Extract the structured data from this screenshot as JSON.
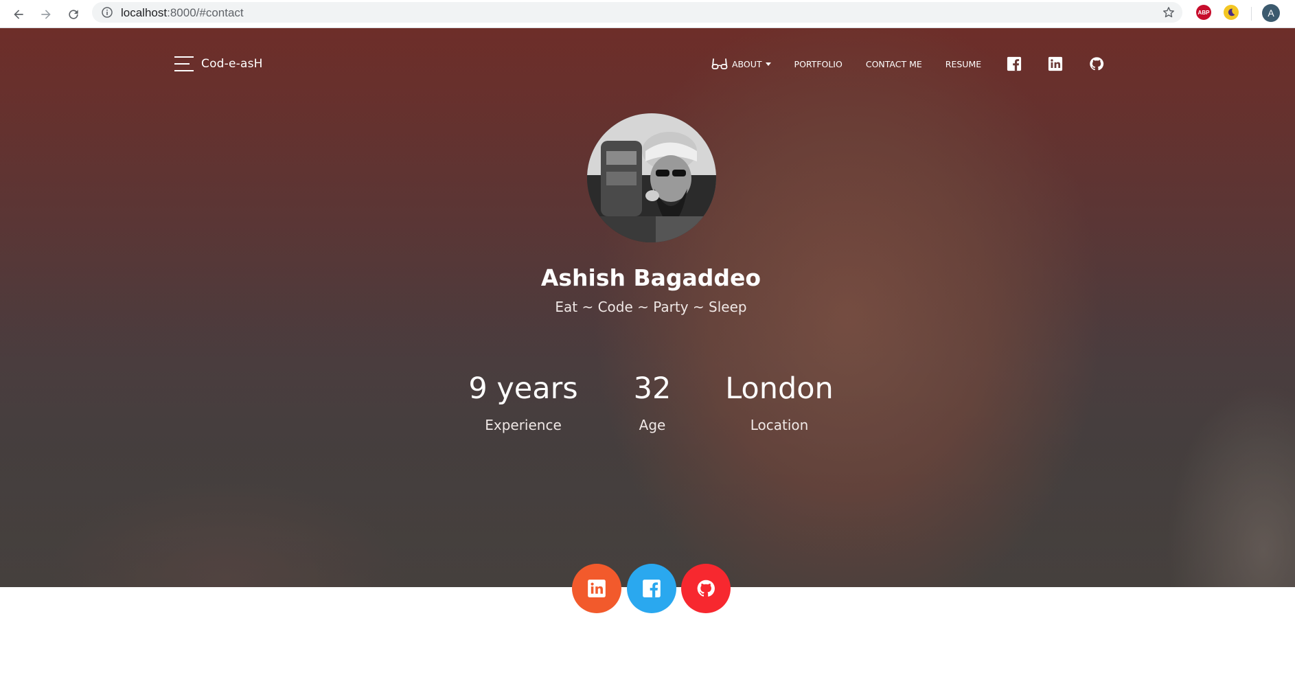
{
  "browser": {
    "url_host": "localhost",
    "url_path": ":8000/#contact",
    "extension_abp": "ABP",
    "profile_initial": "A"
  },
  "header": {
    "brand": "Cod-e-asH",
    "nav": {
      "about": "About",
      "portfolio": "Portfolio",
      "contact": "Contact me",
      "resume": "Resume"
    },
    "icons": [
      "menu-icon",
      "glasses-icon",
      "facebook-icon",
      "linkedin-icon",
      "github-icon"
    ]
  },
  "profile": {
    "name": "Ashish Bagaddeo",
    "tagline": "Eat ~ Code ~ Party ~ Sleep"
  },
  "stats": [
    {
      "value": "9 years",
      "label": "Experience"
    },
    {
      "value": "32",
      "label": "Age"
    },
    {
      "value": "London",
      "label": "Location"
    }
  ],
  "social_buttons": [
    {
      "icon": "linkedin-icon",
      "color": "#f25a2c"
    },
    {
      "icon": "facebook-icon",
      "color": "#2aa8ef"
    },
    {
      "icon": "github-icon",
      "color": "#f7282f"
    }
  ]
}
